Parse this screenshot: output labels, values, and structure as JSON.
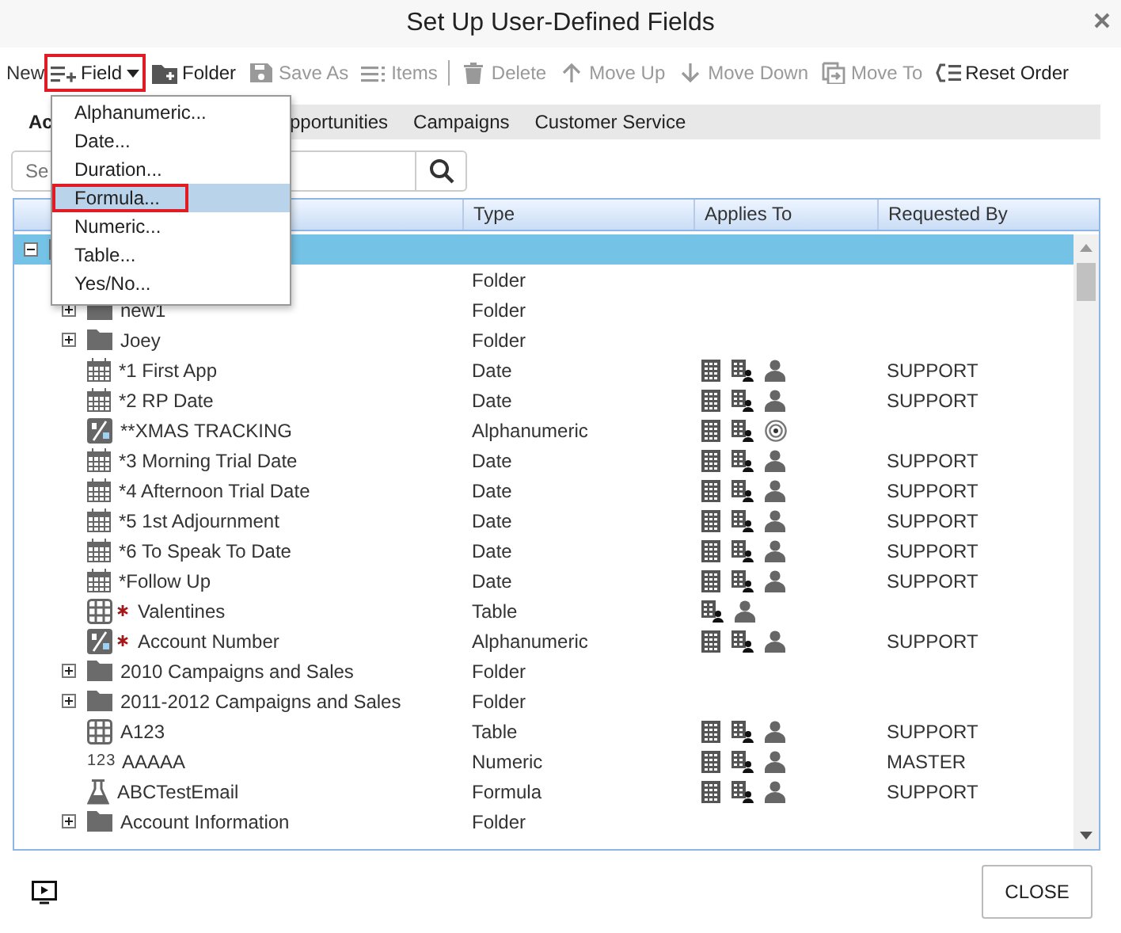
{
  "window": {
    "title": "Set Up User-Defined Fields"
  },
  "toolbar": {
    "label": "New",
    "items": [
      {
        "kind": "field",
        "label": "Field",
        "disabled": false,
        "highlighted": true
      },
      {
        "kind": "folder",
        "label": "Folder",
        "disabled": false,
        "highlighted": false
      },
      {
        "kind": "save",
        "label": "Save As",
        "disabled": true,
        "highlighted": false
      },
      {
        "kind": "items",
        "label": "Items",
        "disabled": true,
        "highlighted": false
      },
      {
        "kind": "separator"
      },
      {
        "kind": "delete",
        "label": "Delete",
        "disabled": true,
        "highlighted": false
      },
      {
        "kind": "up",
        "label": "Move Up",
        "disabled": true,
        "highlighted": false
      },
      {
        "kind": "down",
        "label": "Move Down",
        "disabled": true,
        "highlighted": false
      },
      {
        "kind": "moveto",
        "label": "Move To",
        "disabled": true,
        "highlighted": false
      },
      {
        "kind": "reset",
        "label": "Reset Order",
        "disabled": false,
        "highlighted": false
      }
    ]
  },
  "field_menu": {
    "items": [
      {
        "label": "Alphanumeric...",
        "selected": false
      },
      {
        "label": "Date...",
        "selected": false
      },
      {
        "label": "Duration...",
        "selected": false
      },
      {
        "label": "Formula...",
        "selected": true
      },
      {
        "label": "Numeric...",
        "selected": false
      },
      {
        "label": "Table...",
        "selected": false
      },
      {
        "label": "Yes/No...",
        "selected": false
      }
    ]
  },
  "tabs": [
    {
      "label": "Ac",
      "selected": true
    },
    {
      "label": "pportunities",
      "selected": false
    },
    {
      "label": "Campaigns",
      "selected": false
    },
    {
      "label": "Customer Service",
      "selected": false
    }
  ],
  "search": {
    "placeholder": "Se"
  },
  "table": {
    "columns": [
      "Type",
      "Applies To",
      "Requested By"
    ],
    "rows": [
      {
        "kind": "folder",
        "selected": true,
        "expanded": true,
        "children": [
          {
            "type": "Folder",
            "selected": false
          },
          {
            "kind": "folder",
            "name": "new1",
            "type": "Folder",
            "expanded": false,
            "selected": false
          },
          {
            "kind": "folder",
            "name": "Joey",
            "type": "Folder",
            "expanded": false,
            "selected": false
          },
          {
            "kind": "date",
            "name": "*1 First App",
            "type": "Date",
            "applies_to": [
              {
                "kind": "building"
              },
              {
                "kind": "building-person"
              },
              {
                "kind": "person"
              }
            ],
            "requested_by": "SUPPORT",
            "selected": false
          },
          {
            "kind": "date",
            "name": "*2 RP Date",
            "type": "Date",
            "applies_to": [
              {
                "kind": "building"
              },
              {
                "kind": "building-person"
              },
              {
                "kind": "person"
              }
            ],
            "requested_by": "SUPPORT",
            "selected": false
          },
          {
            "kind": "alphanumeric",
            "name": "**XMAS TRACKING",
            "type": "Alphanumeric",
            "applies_to": [
              {
                "kind": "building"
              },
              {
                "kind": "building-person"
              },
              {
                "kind": "target"
              }
            ],
            "selected": false
          },
          {
            "kind": "date",
            "name": "*3 Morning Trial Date",
            "type": "Date",
            "applies_to": [
              {
                "kind": "building"
              },
              {
                "kind": "building-person"
              },
              {
                "kind": "person"
              }
            ],
            "requested_by": "SUPPORT",
            "selected": false
          },
          {
            "kind": "date",
            "name": "*4 Afternoon Trial Date",
            "type": "Date",
            "applies_to": [
              {
                "kind": "building"
              },
              {
                "kind": "building-person"
              },
              {
                "kind": "person"
              }
            ],
            "requested_by": "SUPPORT",
            "selected": false
          },
          {
            "kind": "date",
            "name": "*5 1st Adjournment",
            "type": "Date",
            "applies_to": [
              {
                "kind": "building"
              },
              {
                "kind": "building-person"
              },
              {
                "kind": "person"
              }
            ],
            "requested_by": "SUPPORT",
            "selected": false
          },
          {
            "kind": "date",
            "name": "*6 To Speak To Date",
            "type": "Date",
            "applies_to": [
              {
                "kind": "building"
              },
              {
                "kind": "building-person"
              },
              {
                "kind": "person"
              }
            ],
            "requested_by": "SUPPORT",
            "selected": false
          },
          {
            "kind": "date",
            "name": "*Follow Up",
            "type": "Date",
            "applies_to": [
              {
                "kind": "building"
              },
              {
                "kind": "building-person"
              },
              {
                "kind": "person"
              }
            ],
            "requested_by": "SUPPORT",
            "selected": false
          },
          {
            "kind": "table",
            "name": "Valentines",
            "type": "Table",
            "required": true,
            "applies_to": [
              {
                "kind": "building-person"
              },
              {
                "kind": "person"
              }
            ],
            "selected": false
          },
          {
            "kind": "alphanumeric",
            "name": "Account Number",
            "type": "Alphanumeric",
            "required": true,
            "applies_to": [
              {
                "kind": "building"
              },
              {
                "kind": "building-person"
              },
              {
                "kind": "person"
              }
            ],
            "requested_by": "SUPPORT",
            "selected": false
          },
          {
            "kind": "folder",
            "name": "2010 Campaigns and Sales",
            "type": "Folder",
            "expanded": false,
            "selected": false
          },
          {
            "kind": "folder",
            "name": "2011-2012 Campaigns and Sales",
            "type": "Folder",
            "expanded": false,
            "selected": false
          },
          {
            "kind": "table",
            "name": "A123",
            "type": "Table",
            "applies_to": [
              {
                "kind": "building"
              },
              {
                "kind": "building-person"
              },
              {
                "kind": "person"
              }
            ],
            "requested_by": "SUPPORT",
            "selected": false
          },
          {
            "kind": "numeric",
            "icon_text": "123",
            "name": "AAAAA",
            "type": "Numeric",
            "applies_to": [
              {
                "kind": "building"
              },
              {
                "kind": "building-person"
              },
              {
                "kind": "person"
              }
            ],
            "requested_by": "MASTER",
            "selected": false
          },
          {
            "kind": "formula",
            "name": "ABCTestEmail",
            "type": "Formula",
            "applies_to": [
              {
                "kind": "building"
              },
              {
                "kind": "building-person"
              },
              {
                "kind": "person"
              }
            ],
            "requested_by": "SUPPORT",
            "selected": false
          },
          {
            "kind": "folder",
            "name": "Account Information",
            "type": "Folder",
            "expanded": false,
            "selected": false
          }
        ]
      }
    ]
  },
  "footer": {
    "close_button": "CLOSE"
  }
}
